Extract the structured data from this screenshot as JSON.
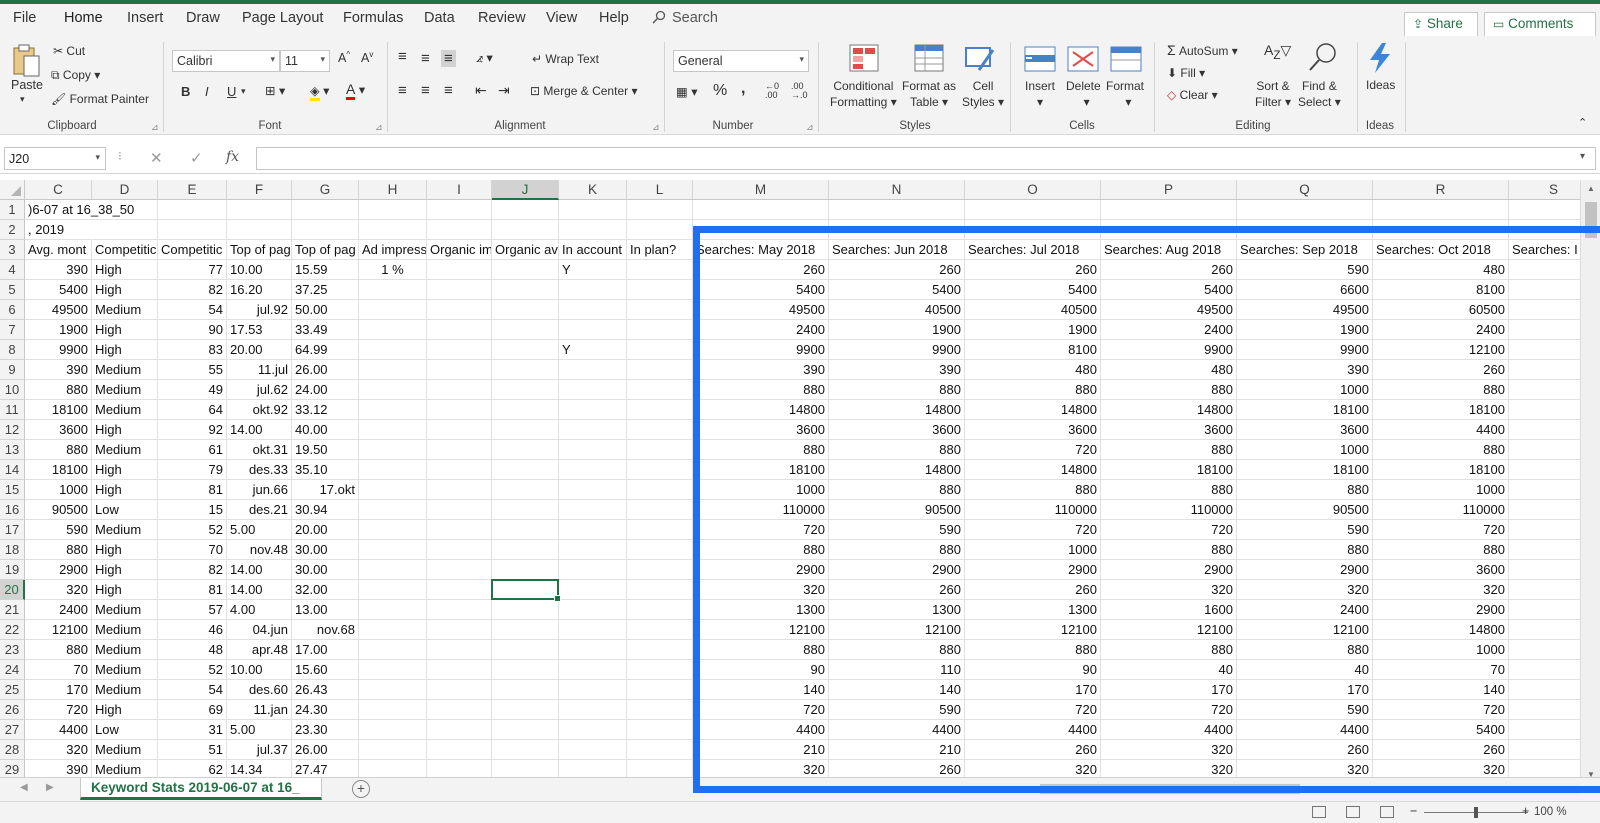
{
  "menu": {
    "items": [
      "File",
      "Home",
      "Insert",
      "Draw",
      "Page Layout",
      "Formulas",
      "Data",
      "Review",
      "View",
      "Help"
    ],
    "search": "Search",
    "share": "Share",
    "comments": "Comments"
  },
  "ribbon": {
    "clipboard": {
      "paste": "Paste",
      "cut": "Cut",
      "copy": "Copy",
      "format_painter": "Format Painter",
      "label": "Clipboard"
    },
    "font": {
      "name": "Calibri",
      "size": "11",
      "bold": "B",
      "italic": "I",
      "underline": "U",
      "label": "Font"
    },
    "alignment": {
      "wrap": "Wrap Text",
      "merge": "Merge & Center",
      "label": "Alignment"
    },
    "number": {
      "format": "General",
      "label": "Number"
    },
    "styles": {
      "conditional": "Conditional",
      "formatting": "Formatting",
      "format_as": "Format as",
      "table": "Table",
      "cell": "Cell",
      "cell_styles": "Styles",
      "label": "Styles"
    },
    "cells": {
      "insert": "Insert",
      "delete": "Delete",
      "format": "Format",
      "label": "Cells"
    },
    "editing": {
      "autosum": "AutoSum",
      "fill": "Fill",
      "clear": "Clear",
      "sort": "Sort &",
      "filter": "Filter",
      "find": "Find &",
      "select": "Select",
      "label": "Editing"
    },
    "ideas": {
      "ideas": "Ideas",
      "label": "Ideas"
    }
  },
  "formula_bar": {
    "name_box": "J20",
    "fx": "fx",
    "content": ""
  },
  "grid": {
    "columns": [
      "C",
      "D",
      "E",
      "F",
      "G",
      "H",
      "I",
      "J",
      "K",
      "L",
      "M",
      "N",
      "O",
      "P",
      "Q",
      "R",
      "S"
    ],
    "selected_column": "J",
    "selected_row": 20,
    "row1_text": ")6-07 at 16_38_50",
    "row2_text": ", 2019",
    "headers": [
      "Avg. mont",
      "Competitic",
      "Competitic",
      "Top of pag",
      "Top of pag",
      "Ad impress",
      "Organic im",
      "Organic av",
      "In account",
      "In plan?",
      "Searches: May 2018",
      "Searches: Jun 2018",
      "Searches: Jul 2018",
      "Searches: Aug 2018",
      "Searches: Sep 2018",
      "Searches: Oct 2018",
      "Searches: I"
    ],
    "rows": [
      [
        "390",
        "High",
        "77",
        "10.00",
        "15.59",
        "1 %",
        "",
        "",
        "Y",
        "",
        "260",
        "260",
        "260",
        "260",
        "590",
        "480"
      ],
      [
        "5400",
        "High",
        "82",
        "16.20",
        "37.25",
        "",
        "",
        "",
        "",
        "",
        "5400",
        "5400",
        "5400",
        "5400",
        "6600",
        "8100"
      ],
      [
        "49500",
        "Medium",
        "54",
        "jul.92",
        "50.00",
        "",
        "",
        "",
        "",
        "",
        "49500",
        "40500",
        "40500",
        "49500",
        "49500",
        "60500"
      ],
      [
        "1900",
        "High",
        "90",
        "17.53",
        "33.49",
        "",
        "",
        "",
        "",
        "",
        "2400",
        "1900",
        "1900",
        "2400",
        "1900",
        "2400"
      ],
      [
        "9900",
        "High",
        "83",
        "20.00",
        "64.99",
        "",
        "",
        "",
        "Y",
        "",
        "9900",
        "9900",
        "8100",
        "9900",
        "9900",
        "12100"
      ],
      [
        "390",
        "Medium",
        "55",
        "11.jul",
        "26.00",
        "",
        "",
        "",
        "",
        "",
        "390",
        "390",
        "480",
        "480",
        "390",
        "260"
      ],
      [
        "880",
        "Medium",
        "49",
        "jul.62",
        "24.00",
        "",
        "",
        "",
        "",
        "",
        "880",
        "880",
        "880",
        "880",
        "1000",
        "880"
      ],
      [
        "18100",
        "Medium",
        "64",
        "okt.92",
        "33.12",
        "",
        "",
        "",
        "",
        "",
        "14800",
        "14800",
        "14800",
        "14800",
        "18100",
        "18100"
      ],
      [
        "3600",
        "High",
        "92",
        "14.00",
        "40.00",
        "",
        "",
        "",
        "",
        "",
        "3600",
        "3600",
        "3600",
        "3600",
        "3600",
        "4400"
      ],
      [
        "880",
        "Medium",
        "61",
        "okt.31",
        "19.50",
        "",
        "",
        "",
        "",
        "",
        "880",
        "880",
        "720",
        "880",
        "1000",
        "880"
      ],
      [
        "18100",
        "High",
        "79",
        "des.33",
        "35.10",
        "",
        "",
        "",
        "",
        "",
        "18100",
        "14800",
        "14800",
        "18100",
        "18100",
        "18100"
      ],
      [
        "1000",
        "High",
        "81",
        "jun.66",
        "17.okt",
        "",
        "",
        "",
        "",
        "",
        "1000",
        "880",
        "880",
        "880",
        "880",
        "1000"
      ],
      [
        "90500",
        "Low",
        "15",
        "des.21",
        "30.94",
        "",
        "",
        "",
        "",
        "",
        "110000",
        "90500",
        "110000",
        "110000",
        "90500",
        "110000"
      ],
      [
        "590",
        "Medium",
        "52",
        "5.00",
        "20.00",
        "",
        "",
        "",
        "",
        "",
        "720",
        "590",
        "720",
        "720",
        "590",
        "720"
      ],
      [
        "880",
        "High",
        "70",
        "nov.48",
        "30.00",
        "",
        "",
        "",
        "",
        "",
        "880",
        "880",
        "1000",
        "880",
        "880",
        "880"
      ],
      [
        "2900",
        "High",
        "82",
        "14.00",
        "30.00",
        "",
        "",
        "",
        "",
        "",
        "2900",
        "2900",
        "2900",
        "2900",
        "2900",
        "3600"
      ],
      [
        "320",
        "High",
        "81",
        "14.00",
        "32.00",
        "",
        "",
        "",
        "",
        "",
        "320",
        "260",
        "260",
        "320",
        "320",
        "320"
      ],
      [
        "2400",
        "Medium",
        "57",
        "4.00",
        "13.00",
        "",
        "",
        "",
        "",
        "",
        "1300",
        "1300",
        "1300",
        "1600",
        "2400",
        "2900"
      ],
      [
        "12100",
        "Medium",
        "46",
        "04.jun",
        "nov.68",
        "",
        "",
        "",
        "",
        "",
        "12100",
        "12100",
        "12100",
        "12100",
        "12100",
        "14800"
      ],
      [
        "880",
        "Medium",
        "48",
        "apr.48",
        "17.00",
        "",
        "",
        "",
        "",
        "",
        "880",
        "880",
        "880",
        "880",
        "880",
        "1000"
      ],
      [
        "70",
        "Medium",
        "52",
        "10.00",
        "15.60",
        "",
        "",
        "",
        "",
        "",
        "90",
        "110",
        "90",
        "40",
        "40",
        "70"
      ],
      [
        "170",
        "Medium",
        "54",
        "des.60",
        "26.43",
        "",
        "",
        "",
        "",
        "",
        "140",
        "140",
        "170",
        "170",
        "170",
        "140"
      ],
      [
        "720",
        "High",
        "69",
        "11.jan",
        "24.30",
        "",
        "",
        "",
        "",
        "",
        "720",
        "590",
        "720",
        "720",
        "590",
        "720"
      ],
      [
        "4400",
        "Low",
        "31",
        "5.00",
        "23.30",
        "",
        "",
        "",
        "",
        "",
        "4400",
        "4400",
        "4400",
        "4400",
        "4400",
        "5400"
      ],
      [
        "320",
        "Medium",
        "51",
        "jul.37",
        "26.00",
        "",
        "",
        "",
        "",
        "",
        "210",
        "210",
        "260",
        "320",
        "260",
        "260"
      ],
      [
        "390",
        "Medium",
        "62",
        "14.34",
        "27.47",
        "",
        "",
        "",
        "",
        "",
        "320",
        "260",
        "320",
        "320",
        "320",
        "320"
      ]
    ]
  },
  "sheet_tab": "Keyword Stats 2019-06-07 at 16_",
  "status": {
    "zoom": "100 %"
  },
  "colors": {
    "accent": "#217346",
    "highlight": "#1f6ff0"
  }
}
